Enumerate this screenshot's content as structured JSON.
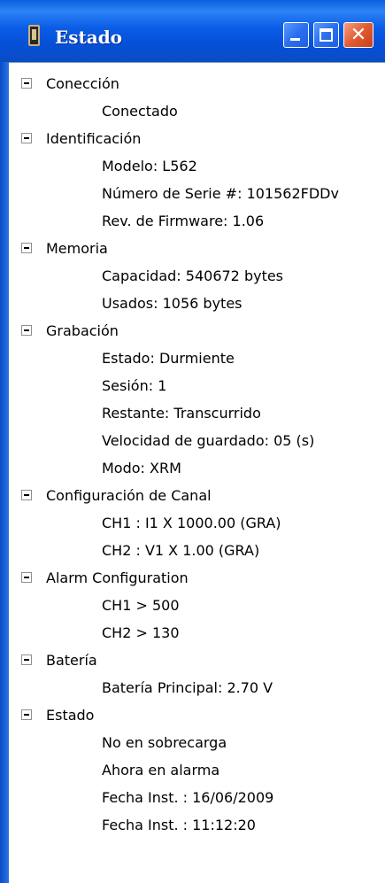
{
  "window": {
    "title": "Estado",
    "icon": "device-icon"
  },
  "tree": [
    {
      "label": "Conección",
      "expanded": true,
      "children": [
        "Conectado"
      ]
    },
    {
      "label": "Identificación",
      "expanded": true,
      "children": [
        "Modelo: L562",
        "Número de Serie #: 101562FDDv",
        "Rev. de Firmware: 1.06"
      ]
    },
    {
      "label": "Memoria",
      "expanded": true,
      "children": [
        "Capacidad: 540672 bytes",
        "Usados: 1056 bytes"
      ]
    },
    {
      "label": "Grabación",
      "expanded": true,
      "children": [
        "Estado: Durmiente",
        "Sesión: 1",
        "Restante: Transcurrido",
        "Velocidad de guardado: 05 (s)",
        "Modo: XRM"
      ]
    },
    {
      "label": "Configuración de Canal",
      "expanded": true,
      "children": [
        "CH1 :  I1 X 1000.00 (GRA)",
        "CH2 :  V1 X 1.00 (GRA)"
      ]
    },
    {
      "label": "Alarm Configuration",
      "expanded": true,
      "children": [
        "CH1 > 500",
        "CH2 > 130"
      ]
    },
    {
      "label": "Batería",
      "expanded": true,
      "children": [
        "Batería Principal: 2.70 V"
      ]
    },
    {
      "label": "Estado",
      "expanded": true,
      "children": [
        "No en sobrecarga",
        "Ahora en alarma",
        "Fecha Inst. : 16/06/2009",
        "Fecha Inst. : 11:12:20"
      ]
    }
  ]
}
